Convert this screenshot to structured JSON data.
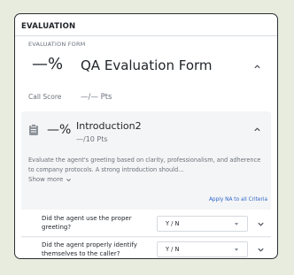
{
  "panel": {
    "header": "EVALUATION"
  },
  "form": {
    "section_label": "EVALUATION FORM",
    "score": "—%",
    "title": "QA Evaluation Form",
    "score_label": "Call Score",
    "points": "—/— Pts"
  },
  "criterion": {
    "score": "—%",
    "title": "Introduction2",
    "points": "—/10 Pts",
    "description": "Evaluate the agent's greeting based on clarity, professionalism, and adherence to company protocols. A strong introduction should…",
    "show_more": "Show more",
    "apply_na": "Apply NA to all Criteria",
    "questions": [
      {
        "text": "Did the agent use the proper greeting?",
        "answer": "Y / N"
      },
      {
        "text": "Did the agent properly identify themselves to the caller?",
        "answer": "Y / N"
      }
    ]
  },
  "colors": {
    "background": "#e8ecdf",
    "card": "#ffffff",
    "link": "#2f66c9"
  },
  "icons": [
    "chevron-up-icon",
    "chevron-down-icon",
    "clipboard-icon",
    "caret-down-icon"
  ]
}
